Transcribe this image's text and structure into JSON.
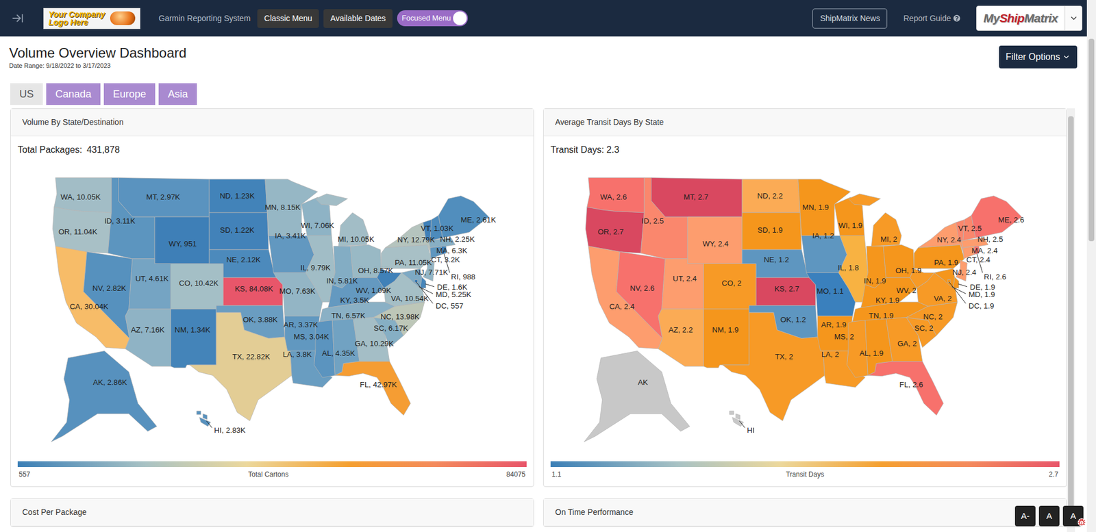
{
  "navbar": {
    "company_logo": [
      "Your Company",
      "Logo Here"
    ],
    "system_name": "Garmin Reporting System",
    "buttons": [
      {
        "label": "Classic Menu"
      },
      {
        "label": "Available Dates"
      }
    ],
    "toggle": {
      "label": "Focused Menu",
      "on": true
    },
    "news_button": "ShipMatrix News",
    "report_guide": "Report Guide",
    "product_logo": [
      {
        "text": "My",
        "color": "#6b6b6b"
      },
      {
        "text": "Ship",
        "color": "#c0232c"
      },
      {
        "text": "Matrix",
        "color": "#6b6b6b"
      }
    ]
  },
  "page": {
    "title": "Volume Overview Dashboard",
    "date_range": "Date Range: 9/18/2022 to 3/17/2023",
    "filter_button": "Filter Options"
  },
  "region_tabs": [
    {
      "label": "US",
      "selected": true
    },
    {
      "label": "Canada",
      "selected": false
    },
    {
      "label": "Europe",
      "selected": false
    },
    {
      "label": "Asia",
      "selected": false
    }
  ],
  "volume_panel": {
    "title": "Volume By State/Destination",
    "summary_label": "Total Packages:",
    "summary_value": "431,878",
    "legend": {
      "min": "557",
      "title": "Total Cartons",
      "max": "84075"
    },
    "states": [
      {
        "label": "WA, 10.05K",
        "value": 10050
      },
      {
        "label": "OR, 11.04K",
        "value": 11040
      },
      {
        "label": "CA, 30.04K",
        "value": 30040
      },
      {
        "label": "NV, 2.82K",
        "value": 2820
      },
      {
        "label": "ID, 3.11K",
        "value": 3110
      },
      {
        "label": "MT, 2.97K",
        "value": 2970
      },
      {
        "label": "WY, 951",
        "value": 951
      },
      {
        "label": "UT, 4.61K",
        "value": 4610
      },
      {
        "label": "CO, 10.42K",
        "value": 10420
      },
      {
        "label": "AZ, 7.16K",
        "value": 7160
      },
      {
        "label": "NM, 1.34K",
        "value": 1340
      },
      {
        "label": "ND, 1.23K",
        "value": 1230
      },
      {
        "label": "SD, 1.22K",
        "value": 1220
      },
      {
        "label": "NE, 2.12K",
        "value": 2120
      },
      {
        "label": "KS, 84.08K",
        "value": 84075
      },
      {
        "label": "OK, 3.88K",
        "value": 3880
      },
      {
        "label": "TX, 22.82K",
        "value": 22820
      },
      {
        "label": "MN, 8.15K",
        "value": 8150
      },
      {
        "label": "IA, 3.41K",
        "value": 3410
      },
      {
        "label": "MO, 7.63K",
        "value": 7630
      },
      {
        "label": "AR, 3.37K",
        "value": 3370
      },
      {
        "label": "LA, 3.8K",
        "value": 3800
      },
      {
        "label": "WI, 7.06K",
        "value": 7060
      },
      {
        "label": "IL, 9.79K",
        "value": 9790
      },
      {
        "label": "MI, 10.05K",
        "value": 10050
      },
      {
        "label": "IN, 5.81K",
        "value": 5810
      },
      {
        "label": "OH, 8.57K",
        "value": 8570
      },
      {
        "label": "KY, 3.5K",
        "value": 3500
      },
      {
        "label": "TN, 6.57K",
        "value": 6570
      },
      {
        "label": "MS, 3.04K",
        "value": 3040
      },
      {
        "label": "AL, 4.35K",
        "value": 4350
      },
      {
        "label": "GA, 10.29K",
        "value": 10290
      },
      {
        "label": "FL, 42.97K",
        "value": 42970
      },
      {
        "label": "SC, 6.17K",
        "value": 6170
      },
      {
        "label": "NC, 13.98K",
        "value": 13980
      },
      {
        "label": "VA, 10.54K",
        "value": 10540
      },
      {
        "label": "WV, 1.09K",
        "value": 1090
      },
      {
        "label": "PA, 11.05K",
        "value": 11050
      },
      {
        "label": "NY, 12.79K",
        "value": 12790
      },
      {
        "label": "NJ, 7.71K",
        "value": 7710
      },
      {
        "label": "DE, 1.6K",
        "value": 1600
      },
      {
        "label": "MD, 5.25K",
        "value": 5250
      },
      {
        "label": "DC, 557",
        "value": 557
      },
      {
        "label": "CT, 3.2K",
        "value": 3200
      },
      {
        "label": "RI, 988",
        "value": 988
      },
      {
        "label": "MA, 6.3K",
        "value": 6300
      },
      {
        "label": "VT, 1.03K",
        "value": 1030
      },
      {
        "label": "NH, 2.25K",
        "value": 2250
      },
      {
        "label": "ME, 2.61K",
        "value": 2610
      },
      {
        "label": "AK, 2.86K",
        "value": 2860
      },
      {
        "label": "HI, 2.83K",
        "value": 2830
      }
    ]
  },
  "transit_panel": {
    "title": "Average Transit Days By State",
    "summary": "Transit Days: 2.3",
    "legend": {
      "min": "1.1",
      "title": "Transit Days",
      "max": "2.7"
    },
    "states": [
      {
        "label": "WA, 2.6",
        "value": 2.6
      },
      {
        "label": "OR, 2.7",
        "value": 2.7
      },
      {
        "label": "CA, 2.4",
        "value": 2.4
      },
      {
        "label": "NV, 2.6",
        "value": 2.6
      },
      {
        "label": "ID, 2.5",
        "value": 2.5
      },
      {
        "label": "MT, 2.7",
        "value": 2.7
      },
      {
        "label": "WY, 2.4",
        "value": 2.4
      },
      {
        "label": "UT, 2.4",
        "value": 2.4
      },
      {
        "label": "CO, 2",
        "value": 2
      },
      {
        "label": "AZ, 2.2",
        "value": 2.2
      },
      {
        "label": "NM, 1.9",
        "value": 1.9
      },
      {
        "label": "ND, 2.2",
        "value": 2.2
      },
      {
        "label": "SD, 1.9",
        "value": 1.9
      },
      {
        "label": "NE, 1.2",
        "value": 1.2
      },
      {
        "label": "KS, 2.7",
        "value": 2.7
      },
      {
        "label": "OK, 1.2",
        "value": 1.2
      },
      {
        "label": "TX, 2",
        "value": 2
      },
      {
        "label": "MN, 1.9",
        "value": 1.9
      },
      {
        "label": "IA, 1.2",
        "value": 1.2
      },
      {
        "label": "MO, 1.1",
        "value": 1.1
      },
      {
        "label": "AR, 1.9",
        "value": 1.9
      },
      {
        "label": "LA, 2",
        "value": 2
      },
      {
        "label": "WI, 1.9",
        "value": 1.9
      },
      {
        "label": "IL, 1.8",
        "value": 1.8
      },
      {
        "label": "MI, 2",
        "value": 2
      },
      {
        "label": "IN, 1.9",
        "value": 1.9
      },
      {
        "label": "OH, 1.9",
        "value": 1.9
      },
      {
        "label": "KY, 1.9",
        "value": 1.9
      },
      {
        "label": "TN, 1.9",
        "value": 1.9
      },
      {
        "label": "MS, 2",
        "value": 2
      },
      {
        "label": "AL, 1.9",
        "value": 1.9
      },
      {
        "label": "GA, 2",
        "value": 2
      },
      {
        "label": "FL, 2.6",
        "value": 2.6
      },
      {
        "label": "SC, 2",
        "value": 2
      },
      {
        "label": "NC, 2",
        "value": 2
      },
      {
        "label": "VA, 2",
        "value": 2
      },
      {
        "label": "WV, 2",
        "value": 2
      },
      {
        "label": "PA, 1.9",
        "value": 1.9
      },
      {
        "label": "NY, 2.4",
        "value": 2.4
      },
      {
        "label": "NJ, 2.4",
        "value": 2.4
      },
      {
        "label": "DE, 1.9",
        "value": 1.9
      },
      {
        "label": "MD, 1.9",
        "value": 1.9
      },
      {
        "label": "DC, 1.9",
        "value": 1.9
      },
      {
        "label": "CT, 2.4",
        "value": 2.4
      },
      {
        "label": "RI, 2.6",
        "value": 2.6
      },
      {
        "label": "MA, 2.4",
        "value": 2.4
      },
      {
        "label": "VT, 2.5",
        "value": 2.5
      },
      {
        "label": "NH, 2.5",
        "value": 2.5
      },
      {
        "label": "ME, 2.6",
        "value": 2.6
      },
      {
        "label": "AK",
        "value": null
      },
      {
        "label": "HI",
        "value": null
      }
    ]
  },
  "lower_panels": [
    {
      "title": "Cost Per Package"
    },
    {
      "title": "On Time Performance"
    }
  ],
  "font_size_buttons": [
    "A-",
    "A",
    "A"
  ]
}
